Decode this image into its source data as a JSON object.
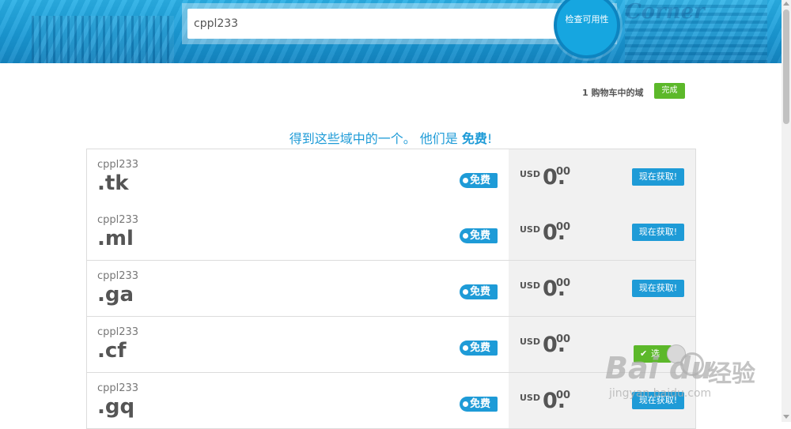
{
  "search": {
    "value": "cppl233",
    "button_label": "检查可用性"
  },
  "cart": {
    "status_text": "1 购物车中的域",
    "done_label": "完成"
  },
  "offer": {
    "text": "得到这些域中的一个。 他们是",
    "free_word": "免费",
    "suffix": "!"
  },
  "rows": [
    {
      "name": "cppl233",
      "tld": ".tk",
      "badge": "免费",
      "currency": "USD",
      "amount": "0.",
      "cents": "00",
      "action": "现在获取!",
      "selected": false
    },
    {
      "name": "cppl233",
      "tld": ".ml",
      "badge": "免费",
      "currency": "USD",
      "amount": "0.",
      "cents": "00",
      "action": "现在获取!",
      "selected": false
    },
    {
      "name": "cppl233",
      "tld": ".ga",
      "badge": "免费",
      "currency": "USD",
      "amount": "0.",
      "cents": "00",
      "action": "现在获取!",
      "selected": false
    },
    {
      "name": "cppl233",
      "tld": ".cf",
      "badge": "免费",
      "currency": "USD",
      "amount": "0.",
      "cents": "00",
      "action": "选",
      "selected": true
    },
    {
      "name": "cppl233",
      "tld": ".gq",
      "badge": "免费",
      "currency": "USD",
      "amount": "0.",
      "cents": "00",
      "action": "现在获取!",
      "selected": false
    }
  ],
  "hero_sign_text": "Corner",
  "watermark": {
    "logo": "Bai du",
    "cn": "经验",
    "url": "jingyan.baidu.com"
  },
  "colors": {
    "accent": "#1e9bd7",
    "success": "#5cb82a",
    "price_bg": "#f1f1f1"
  },
  "icons": {
    "check": "check-icon",
    "paw": "baidu-paw-icon"
  }
}
